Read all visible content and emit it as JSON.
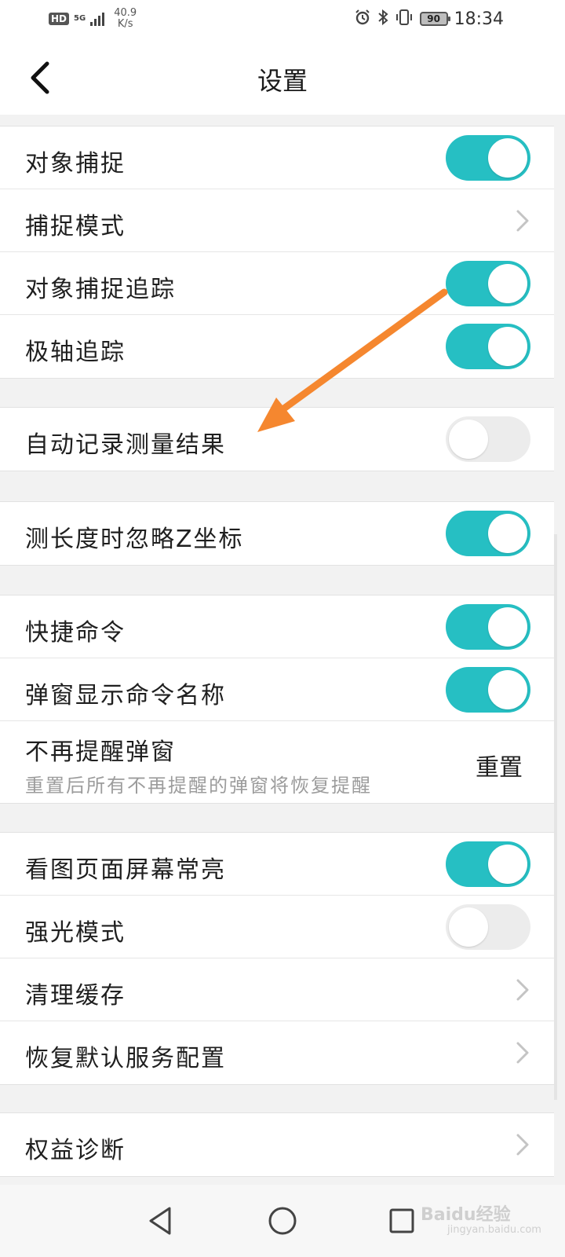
{
  "status_bar": {
    "hd": "HD",
    "network": "5G",
    "speed_value": "40.9",
    "speed_unit": "K/s",
    "icons": [
      "alarm-icon",
      "bluetooth-icon",
      "vibrate-icon"
    ],
    "battery": "90",
    "time": "18:34"
  },
  "header": {
    "title": "设置",
    "back_icon": "chevron-left-icon"
  },
  "settings": {
    "object_snap": {
      "label": "对象捕捉",
      "on": true
    },
    "snap_mode": {
      "label": "捕捉模式"
    },
    "snap_tracking": {
      "label": "对象捕捉追踪",
      "on": true
    },
    "polar_tracking": {
      "label": "极轴追踪",
      "on": true
    },
    "auto_record": {
      "label": "自动记录测量结果",
      "on": false
    },
    "ignore_z": {
      "label": "测长度时忽略Z坐标",
      "on": true
    },
    "quick_command": {
      "label": "快捷命令",
      "on": true
    },
    "popup_command_name": {
      "label": "弹窗显示命令名称",
      "on": true
    },
    "no_remind_popup": {
      "label": "不再提醒弹窗",
      "sublabel": "重置后所有不再提醒的弹窗将恢复提醒",
      "action": "重置"
    },
    "screen_always_on": {
      "label": "看图页面屏幕常亮",
      "on": true
    },
    "strong_light": {
      "label": "强光模式",
      "on": false
    },
    "clear_cache": {
      "label": "清理缓存"
    },
    "restore_default": {
      "label": "恢复默认服务配置"
    },
    "rights_diagnosis": {
      "label": "权益诊断"
    }
  },
  "nav_bar": {
    "icons": [
      "back-triangle-icon",
      "home-circle-icon",
      "recents-square-icon"
    ]
  },
  "watermark": {
    "text": "Baidu经验",
    "sub": "jingyan.baidu.com"
  },
  "colors": {
    "toggle_on": "#26bfc3",
    "toggle_off": "#ececec",
    "arrow": "#f5872f"
  }
}
